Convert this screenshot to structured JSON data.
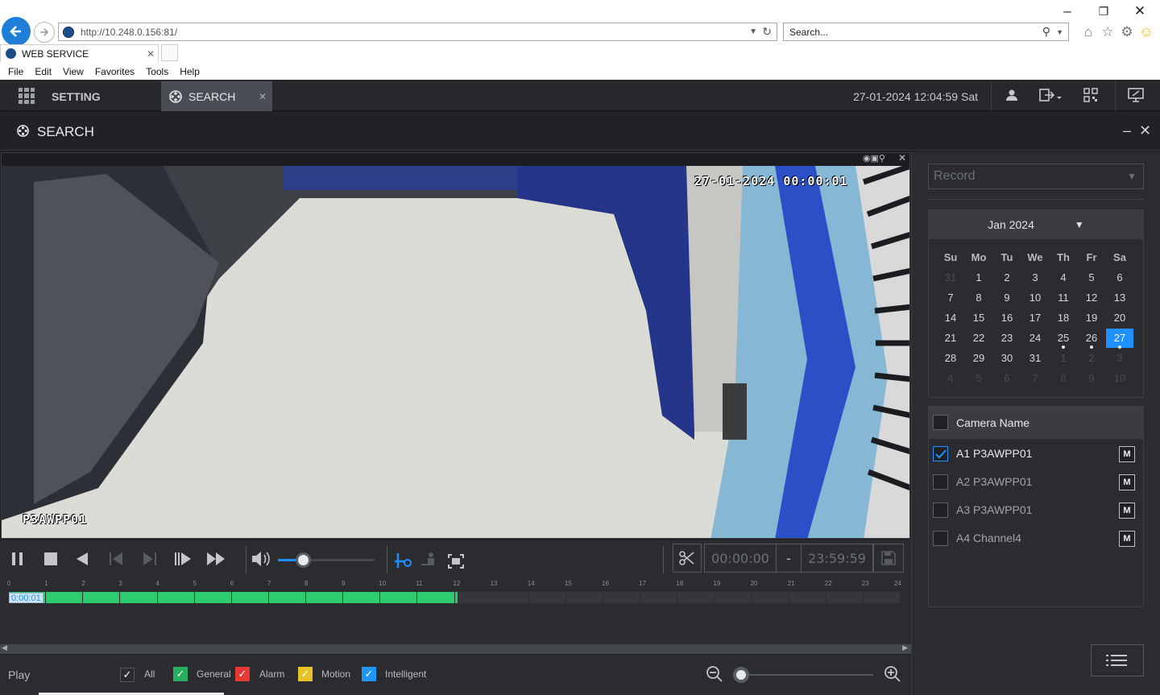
{
  "browser": {
    "address": "http://10.248.0.156:81/",
    "address_host": "10.248.0.156",
    "search_placeholder": "Search...",
    "tab_title": "WEB SERVICE",
    "menu": [
      "File",
      "Edit",
      "View",
      "Favorites",
      "Tools",
      "Help"
    ]
  },
  "app": {
    "setting_label": "SETTING",
    "search_tab_label": "SEARCH",
    "datetime": "27-01-2024 12:04:59 Sat",
    "panel_title": "SEARCH"
  },
  "video": {
    "osd_timestamp": "27-01-2024 00:00:01",
    "osd_channel": "P3AWPP01"
  },
  "controls": {
    "volume_level": 0.5,
    "clip_start": "00:00:00",
    "clip_dash": "-",
    "clip_end": "23:59:59"
  },
  "timeline": {
    "hours": [
      "0",
      "1",
      "2",
      "3",
      "4",
      "5",
      "6",
      "7",
      "8",
      "9",
      "10",
      "11",
      "12",
      "13",
      "14",
      "15",
      "16",
      "17",
      "18",
      "19",
      "20",
      "21",
      "22",
      "23",
      "24"
    ],
    "current_time": "0:00:01",
    "recorded_until_hour": 12.1,
    "record_color": "#2ecc71"
  },
  "legend": {
    "play_label": "Play",
    "items": [
      {
        "label": "All",
        "color": "#2a2c30"
      },
      {
        "label": "General",
        "color": "#27ae60"
      },
      {
        "label": "Alarm",
        "color": "#e53935"
      },
      {
        "label": "Motion",
        "color": "#e6c229"
      },
      {
        "label": "Intelligent",
        "color": "#2196f3"
      }
    ],
    "zoom_level": 0.0
  },
  "right": {
    "record_type": "Record",
    "month_label": "Jan 2024",
    "weekdays": [
      "Su",
      "Mo",
      "Tu",
      "We",
      "Th",
      "Fr",
      "Sa"
    ],
    "days": [
      [
        "31",
        "1",
        "2",
        "3",
        "4",
        "5",
        "6"
      ],
      [
        "7",
        "8",
        "9",
        "10",
        "11",
        "12",
        "13"
      ],
      [
        "14",
        "15",
        "16",
        "17",
        "18",
        "19",
        "20"
      ],
      [
        "21",
        "22",
        "23",
        "24",
        "25",
        "26",
        "27"
      ],
      [
        "28",
        "29",
        "30",
        "31",
        "1",
        "2",
        "3"
      ],
      [
        "4",
        "5",
        "6",
        "7",
        "8",
        "9",
        "10"
      ]
    ],
    "selected_day": "27",
    "days_with_records": [
      "25",
      "26",
      "27"
    ],
    "camera_header": "Camera Name",
    "cameras": [
      {
        "name": "A1 P3AWPP01",
        "checked": true,
        "m": "M"
      },
      {
        "name": "A2 P3AWPP01",
        "checked": false,
        "m": "M"
      },
      {
        "name": "A3 P3AWPP01",
        "checked": false,
        "m": "M"
      },
      {
        "name": "A4 Channel4",
        "checked": false,
        "m": "M"
      }
    ]
  },
  "colors": {
    "accent": "#1e90ff",
    "app_bg": "#2a2c30",
    "selected_day": "#1e90ff"
  }
}
